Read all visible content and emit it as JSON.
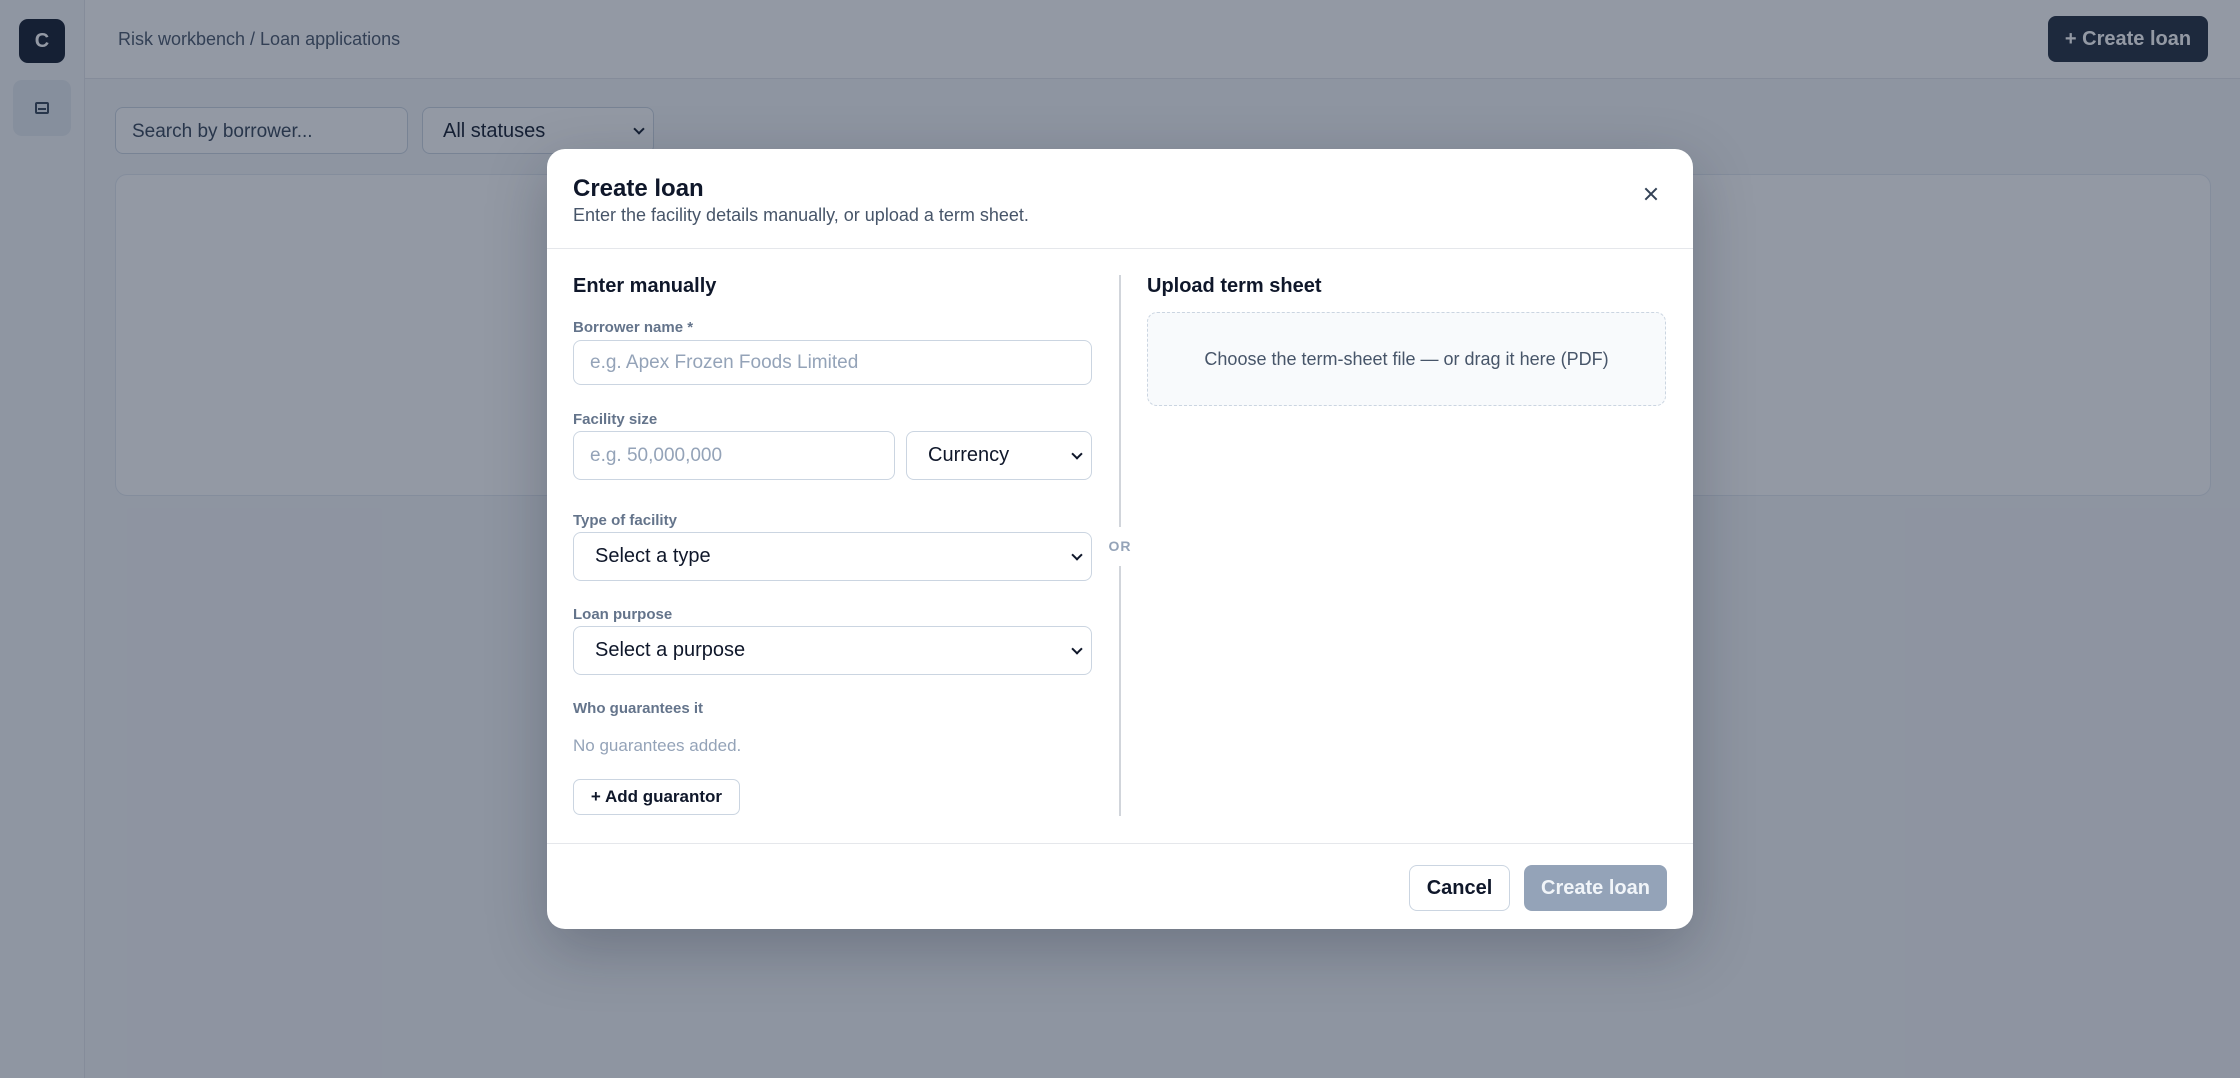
{
  "app": {
    "logo_letter": "C",
    "breadcrumb": "Risk workbench / Loan applications",
    "create_button_label": "+ Create loan",
    "search_placeholder": "Search by borrower...",
    "status_filter_value": "All statuses"
  },
  "modal": {
    "title": "Create loan",
    "subtitle": "Enter the facility details manually, or upload a term sheet.",
    "manual": {
      "section_title": "Enter manually",
      "borrower_label": "Borrower name *",
      "borrower_placeholder": "e.g. Apex Frozen Foods Limited",
      "facility_size_label": "Facility size",
      "facility_size_placeholder": "e.g. 50,000,000",
      "currency_value": "Currency",
      "facility_type_label": "Type of facility",
      "facility_type_value": "Select a type",
      "purpose_label": "Loan purpose",
      "purpose_value": "Select a purpose",
      "guarantees_label": "Who guarantees it",
      "guarantees_empty": "No guarantees added.",
      "add_guarantor_label": "+ Add guarantor"
    },
    "or_label": "OR",
    "upload": {
      "section_title": "Upload term sheet",
      "dropzone_text": "Choose the term-sheet file — or drag it here (PDF)"
    },
    "footer": {
      "cancel_label": "Cancel",
      "create_label": "Create loan"
    }
  },
  "colors": {
    "primary_dark": "#1e293b",
    "disabled_button": "#94a3b8",
    "overlay": "rgba(30, 41, 65, 0.48)"
  },
  "icons": {
    "logo": "logo-c",
    "rail_item": "document-icon",
    "close": "close-icon",
    "select_chevron": "chevron-down-icon"
  }
}
